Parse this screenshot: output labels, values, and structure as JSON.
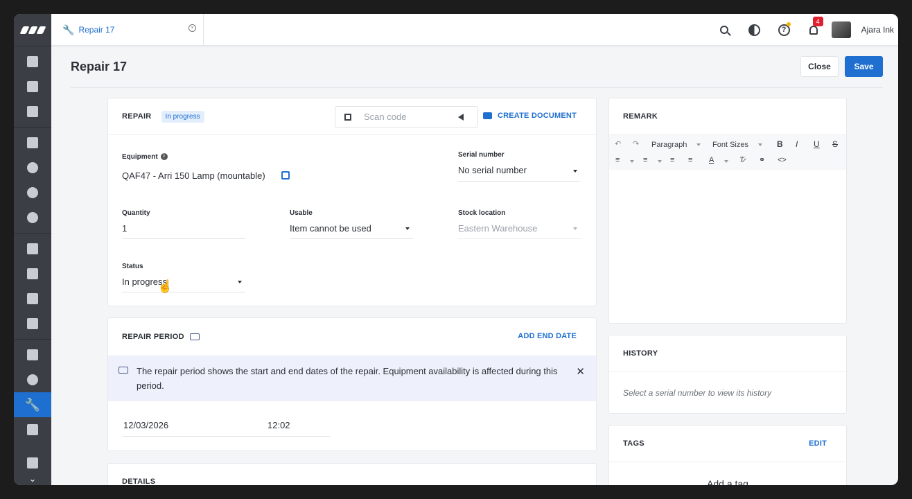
{
  "tab": {
    "label": "Repair 17"
  },
  "user": {
    "name": "Ajara Ink",
    "notifications": "4"
  },
  "page": {
    "title": "Repair 17",
    "close_label": "Close",
    "save_label": "Save"
  },
  "repair": {
    "title": "REPAIR",
    "status_pill": "In progress",
    "scan_placeholder": "Scan code",
    "create_document": "CREATE DOCUMENT",
    "equipment_label": "Equipment",
    "equipment_value": "QAF47 - Arri 150 Lamp (mountable)",
    "serial_label": "Serial number",
    "serial_value": "No serial number",
    "quantity_label": "Quantity",
    "quantity_value": "1",
    "usable_label": "Usable",
    "usable_value": "Item cannot be used",
    "stock_label": "Stock location",
    "stock_value": "Eastern Warehouse",
    "status_label": "Status",
    "status_value": "In progress"
  },
  "period": {
    "title": "REPAIR PERIOD",
    "add_end_date": "ADD END DATE",
    "info": "The repair period shows the start and end dates of the repair. Equipment availability is affected during this period.",
    "start_date": "12/03/2026",
    "start_time": "12:02"
  },
  "details": {
    "title": "DETAILS"
  },
  "remark": {
    "title": "REMARK",
    "paragraph": "Paragraph",
    "font_sizes": "Font Sizes"
  },
  "history": {
    "title": "HISTORY",
    "empty": "Select a serial number to view its history"
  },
  "tags": {
    "title": "TAGS",
    "edit": "EDIT",
    "add": "Add a tag"
  },
  "colors": {
    "accent": "#1f6fd1",
    "sidebar": "#3b3f45",
    "badge": "#e0202e"
  }
}
